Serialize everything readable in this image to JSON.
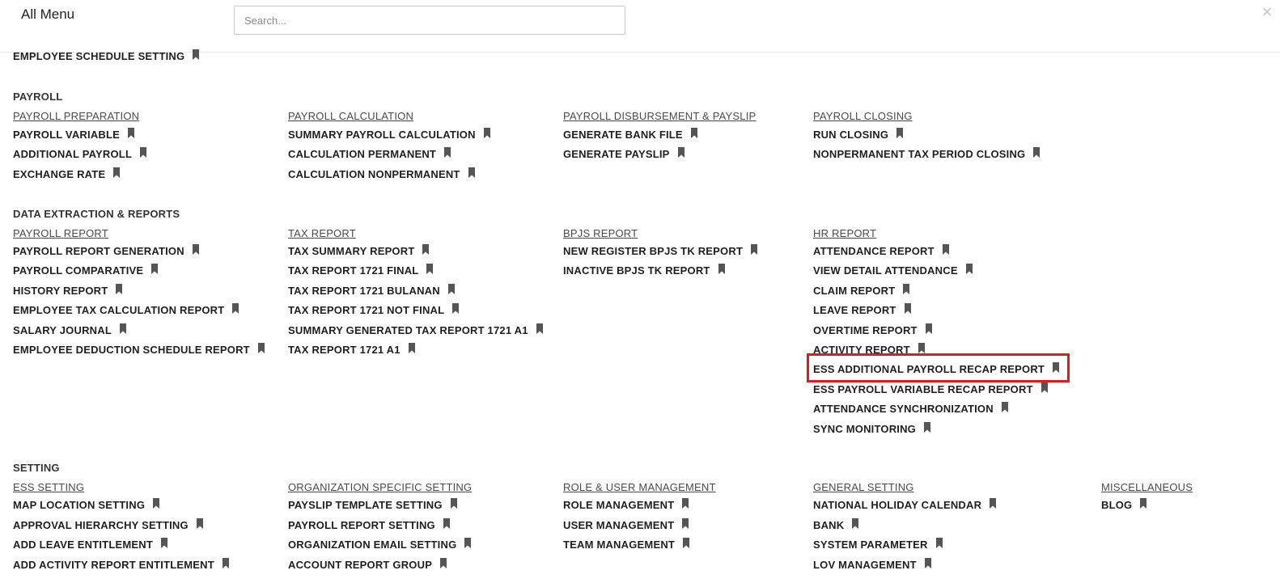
{
  "header": {
    "title": "All Menu",
    "search_placeholder": "Search...",
    "close_label": "×"
  },
  "top_item": {
    "label": "EMPLOYEE SCHEDULE SETTING"
  },
  "payroll": {
    "title": "PAYROLL",
    "groups": [
      {
        "header": "PAYROLL PREPARATION",
        "items": [
          "PAYROLL VARIABLE",
          "ADDITIONAL PAYROLL",
          "EXCHANGE RATE"
        ]
      },
      {
        "header": "PAYROLL CALCULATION",
        "items": [
          "SUMMARY PAYROLL CALCULATION",
          "CALCULATION PERMANENT",
          "CALCULATION NONPERMANENT"
        ]
      },
      {
        "header": "PAYROLL DISBURSEMENT & PAYSLIP",
        "items": [
          "GENERATE BANK FILE",
          "GENERATE PAYSLIP"
        ]
      },
      {
        "header": "PAYROLL CLOSING",
        "items": [
          "RUN CLOSING",
          "NONPERMANENT TAX PERIOD CLOSING"
        ]
      }
    ]
  },
  "reports": {
    "title": "DATA EXTRACTION & REPORTS",
    "groups": [
      {
        "header": "PAYROLL REPORT",
        "items": [
          "PAYROLL REPORT GENERATION",
          "PAYROLL COMPARATIVE",
          "HISTORY REPORT",
          "EMPLOYEE TAX CALCULATION REPORT",
          "SALARY JOURNAL",
          "EMPLOYEE DEDUCTION SCHEDULE REPORT"
        ]
      },
      {
        "header": "TAX REPORT",
        "items": [
          "TAX SUMMARY REPORT",
          "TAX REPORT 1721 FINAL",
          "TAX REPORT 1721 BULANAN",
          "TAX REPORT 1721 NOT FINAL",
          "SUMMARY GENERATED TAX REPORT 1721 A1",
          "TAX REPORT 1721 A1"
        ]
      },
      {
        "header": "BPJS REPORT",
        "items": [
          "NEW REGISTER BPJS TK REPORT",
          "INACTIVE BPJS TK REPORT"
        ]
      },
      {
        "header": "HR REPORT",
        "items": [
          "ATTENDANCE REPORT",
          "VIEW DETAIL ATTENDANCE",
          "CLAIM REPORT",
          "LEAVE REPORT",
          "OVERTIME REPORT",
          "ACTIVITY REPORT",
          "ESS ADDITIONAL PAYROLL RECAP REPORT",
          "ESS PAYROLL VARIABLE RECAP REPORT",
          "ATTENDANCE SYNCHRONIZATION",
          "SYNC MONITORING"
        ]
      }
    ]
  },
  "setting": {
    "title": "SETTING",
    "groups": [
      {
        "header": "ESS SETTING",
        "items": [
          "MAP LOCATION SETTING",
          "APPROVAL HIERARCHY SETTING",
          "ADD LEAVE ENTITLEMENT",
          "ADD ACTIVITY REPORT ENTITLEMENT"
        ]
      },
      {
        "header": "ORGANIZATION SPECIFIC SETTING",
        "items": [
          "PAYSLIP TEMPLATE SETTING",
          "PAYROLL REPORT SETTING",
          "ORGANIZATION EMAIL SETTING",
          "ACCOUNT REPORT GROUP"
        ]
      },
      {
        "header": "ROLE & USER MANAGEMENT",
        "items": [
          "ROLE MANAGEMENT",
          "USER MANAGEMENT",
          "TEAM MANAGEMENT"
        ]
      },
      {
        "header": "GENERAL SETTING",
        "items": [
          "NATIONAL HOLIDAY CALENDAR",
          "BANK",
          "SYSTEM PARAMETER",
          "LOV MANAGEMENT"
        ]
      },
      {
        "header": "MISCELLANEOUS",
        "items": [
          "BLOG"
        ]
      }
    ]
  },
  "highlighted_item": "ESS ADDITIONAL PAYROLL RECAP REPORT",
  "colors": {
    "highlight": "#e01b1b",
    "bookmark": "#555555",
    "header_link": "#4a4a4a"
  },
  "icons": {
    "item_icon": "bookmark-icon",
    "close": "close-icon"
  }
}
